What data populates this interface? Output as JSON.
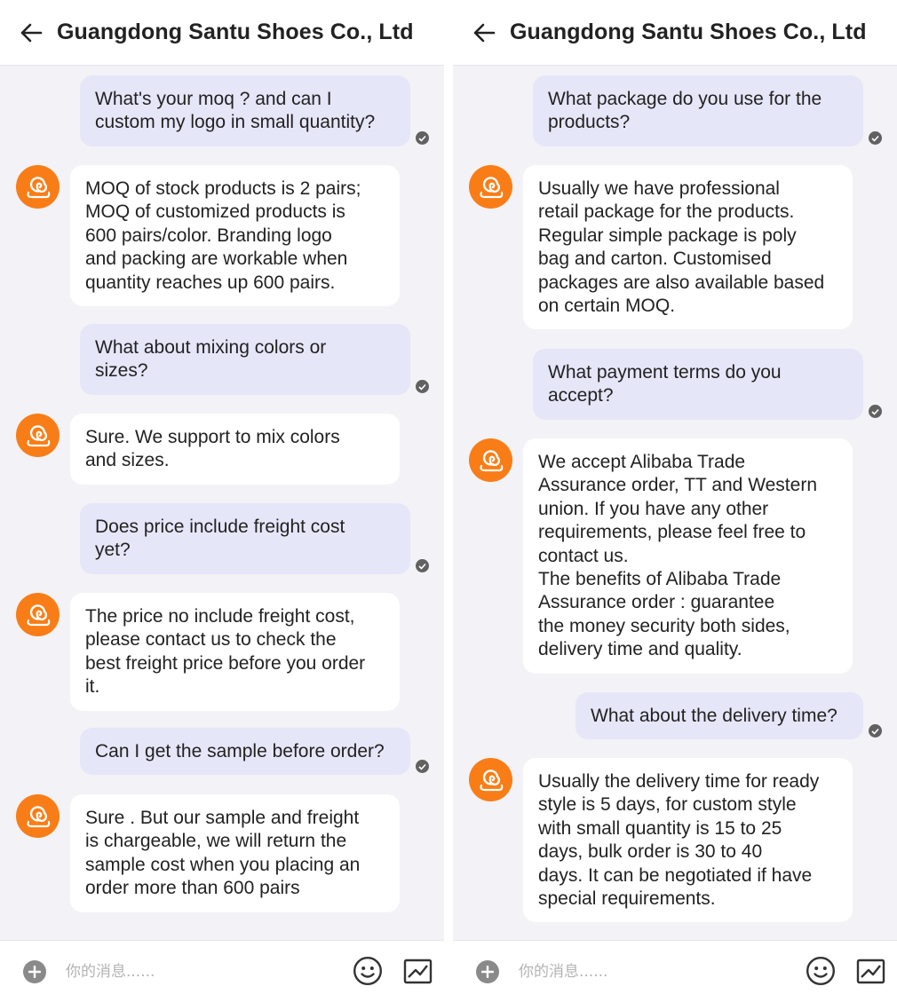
{
  "app": {
    "chat_title": "Guangdong Santu Shoes Co., Ltd",
    "input_placeholder": "你的消息......",
    "icons": {
      "back": "arrow-left-icon",
      "avatar": "snail-logo-icon",
      "read": "check-circle-icon",
      "add": "plus-circle-icon",
      "emoji": "smiley-face-icon",
      "image": "image-icon"
    },
    "colors": {
      "outgoing_bubble": "#e6e6f9",
      "incoming_bubble": "#ffffff",
      "background": "#f2f2f7",
      "avatar": "#f97d16"
    }
  },
  "left": {
    "messages": [
      {
        "from": "buyer",
        "text": "What's your moq ? and can I\ncustom my logo in small quantity?"
      },
      {
        "from": "supplier",
        "text": "MOQ of stock products is 2 pairs;\nMOQ of customized products is\n600 pairs/color. Branding logo\nand packing are workable when\nquantity reaches up 600 pairs."
      },
      {
        "from": "buyer",
        "text": "What about mixing colors or\nsizes?"
      },
      {
        "from": "supplier",
        "text": "Sure. We support to mix colors\nand sizes."
      },
      {
        "from": "buyer",
        "text": "Does price include freight cost\nyet?"
      },
      {
        "from": "supplier",
        "text": "The price no include freight cost,\nplease contact us to check the\nbest freight price before you order\nit."
      },
      {
        "from": "buyer",
        "text": "Can I get the sample before order?"
      },
      {
        "from": "supplier",
        "text": "Sure . But our sample and freight\nis chargeable, we will return the\nsample cost when you placing an\norder more than 600 pairs"
      }
    ]
  },
  "right": {
    "messages": [
      {
        "from": "buyer",
        "text": "What package do you use for the\nproducts?"
      },
      {
        "from": "supplier",
        "text": "Usually we have professional\nretail package for the products.\nRegular simple package is poly\nbag and carton. Customised\npackages are also available based\non certain MOQ."
      },
      {
        "from": "buyer",
        "text": "What payment terms do you\naccept?"
      },
      {
        "from": "supplier",
        "text": "We accept Alibaba Trade\nAssurance order, TT and Western\nunion. If you have any other\nrequirements, please feel free to\ncontact us.\nThe benefits of Alibaba Trade\nAssurance order : guarantee\nthe money security both sides,\ndelivery time and quality."
      },
      {
        "from": "buyer",
        "text": "What about the delivery time?"
      },
      {
        "from": "supplier",
        "text": "Usually the delivery time for ready\nstyle is 5 days, for custom style\nwith small quantity is 15 to 25\ndays, bulk order is 30 to 40\ndays. It can be negotiated if have\nspecial requirements."
      }
    ]
  }
}
